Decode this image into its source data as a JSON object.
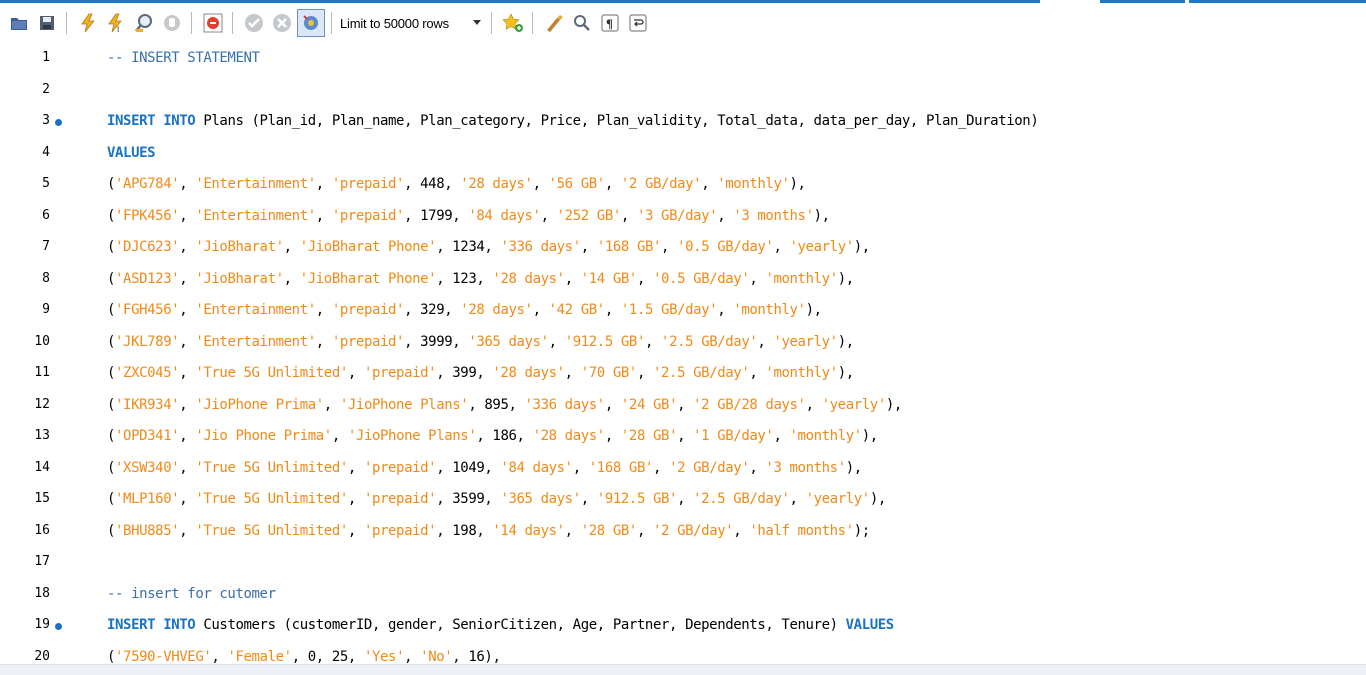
{
  "toolbar": {
    "buttons_left": [
      {
        "name": "open-folder-icon",
        "color": "#4a6a9a"
      },
      {
        "name": "save-icon",
        "color": "#5a6a7a"
      },
      {
        "name": "execute-icon",
        "color": "#e0a020"
      },
      {
        "name": "execute-current-icon",
        "color": "#e0a020"
      },
      {
        "name": "explain-icon",
        "color": "#5a6a7a"
      },
      {
        "name": "stop-icon",
        "color": "#b0b0b0"
      }
    ],
    "limit_label": "Limit to 50000 rows",
    "accent": "#1e78c8"
  },
  "editor": {
    "colors": {
      "keyword": "#1a73c0",
      "string": "#f08a17",
      "comment": "#3a6fa8",
      "statement_dot": "#1e6fc8"
    },
    "lines": [
      {
        "n": "1",
        "dot": false,
        "tokens": [
          {
            "t": "-- INSERT STATEMENT",
            "c": "cmt"
          }
        ]
      },
      {
        "n": "2",
        "dot": false,
        "tokens": []
      },
      {
        "n": "3",
        "dot": true,
        "tokens": [
          {
            "t": "INSERT INTO",
            "c": "kw"
          },
          {
            "t": " Plans (Plan_id, Plan_name, Plan_category, Price, Plan_validity, Total_data, data_per_day, Plan_Duration)",
            "c": "txt"
          }
        ]
      },
      {
        "n": "4",
        "dot": false,
        "tokens": [
          {
            "t": "VALUES",
            "c": "kw"
          }
        ]
      },
      {
        "n": "5",
        "dot": false,
        "tokens": [
          {
            "t": "(",
            "c": "txt"
          },
          {
            "t": "'APG784'",
            "c": "str"
          },
          {
            "t": ", ",
            "c": "txt"
          },
          {
            "t": "'Entertainment'",
            "c": "str"
          },
          {
            "t": ", ",
            "c": "txt"
          },
          {
            "t": "'prepaid'",
            "c": "str"
          },
          {
            "t": ", 448, ",
            "c": "txt"
          },
          {
            "t": "'28 days'",
            "c": "str"
          },
          {
            "t": ", ",
            "c": "txt"
          },
          {
            "t": "'56 GB'",
            "c": "str"
          },
          {
            "t": ", ",
            "c": "txt"
          },
          {
            "t": "'2 GB/day'",
            "c": "str"
          },
          {
            "t": ", ",
            "c": "txt"
          },
          {
            "t": "'monthly'",
            "c": "str"
          },
          {
            "t": "),",
            "c": "txt"
          }
        ]
      },
      {
        "n": "6",
        "dot": false,
        "tokens": [
          {
            "t": "(",
            "c": "txt"
          },
          {
            "t": "'FPK456'",
            "c": "str"
          },
          {
            "t": ", ",
            "c": "txt"
          },
          {
            "t": "'Entertainment'",
            "c": "str"
          },
          {
            "t": ", ",
            "c": "txt"
          },
          {
            "t": "'prepaid'",
            "c": "str"
          },
          {
            "t": ", 1799, ",
            "c": "txt"
          },
          {
            "t": "'84 days'",
            "c": "str"
          },
          {
            "t": ", ",
            "c": "txt"
          },
          {
            "t": "'252 GB'",
            "c": "str"
          },
          {
            "t": ", ",
            "c": "txt"
          },
          {
            "t": "'3 GB/day'",
            "c": "str"
          },
          {
            "t": ", ",
            "c": "txt"
          },
          {
            "t": "'3 months'",
            "c": "str"
          },
          {
            "t": "),",
            "c": "txt"
          }
        ]
      },
      {
        "n": "7",
        "dot": false,
        "tokens": [
          {
            "t": "(",
            "c": "txt"
          },
          {
            "t": "'DJC623'",
            "c": "str"
          },
          {
            "t": ", ",
            "c": "txt"
          },
          {
            "t": "'JioBharat'",
            "c": "str"
          },
          {
            "t": ", ",
            "c": "txt"
          },
          {
            "t": "'JioBharat Phone'",
            "c": "str"
          },
          {
            "t": ", 1234, ",
            "c": "txt"
          },
          {
            "t": "'336 days'",
            "c": "str"
          },
          {
            "t": ", ",
            "c": "txt"
          },
          {
            "t": "'168 GB'",
            "c": "str"
          },
          {
            "t": ", ",
            "c": "txt"
          },
          {
            "t": "'0.5 GB/day'",
            "c": "str"
          },
          {
            "t": ", ",
            "c": "txt"
          },
          {
            "t": "'yearly'",
            "c": "str"
          },
          {
            "t": "),",
            "c": "txt"
          }
        ]
      },
      {
        "n": "8",
        "dot": false,
        "tokens": [
          {
            "t": "(",
            "c": "txt"
          },
          {
            "t": "'ASD123'",
            "c": "str"
          },
          {
            "t": ", ",
            "c": "txt"
          },
          {
            "t": "'JioBharat'",
            "c": "str"
          },
          {
            "t": ", ",
            "c": "txt"
          },
          {
            "t": "'JioBharat Phone'",
            "c": "str"
          },
          {
            "t": ", 123, ",
            "c": "txt"
          },
          {
            "t": "'28 days'",
            "c": "str"
          },
          {
            "t": ", ",
            "c": "txt"
          },
          {
            "t": "'14 GB'",
            "c": "str"
          },
          {
            "t": ", ",
            "c": "txt"
          },
          {
            "t": "'0.5 GB/day'",
            "c": "str"
          },
          {
            "t": ", ",
            "c": "txt"
          },
          {
            "t": "'monthly'",
            "c": "str"
          },
          {
            "t": "),",
            "c": "txt"
          }
        ]
      },
      {
        "n": "9",
        "dot": false,
        "tokens": [
          {
            "t": "(",
            "c": "txt"
          },
          {
            "t": "'FGH456'",
            "c": "str"
          },
          {
            "t": ", ",
            "c": "txt"
          },
          {
            "t": "'Entertainment'",
            "c": "str"
          },
          {
            "t": ", ",
            "c": "txt"
          },
          {
            "t": "'prepaid'",
            "c": "str"
          },
          {
            "t": ", 329, ",
            "c": "txt"
          },
          {
            "t": "'28 days'",
            "c": "str"
          },
          {
            "t": ", ",
            "c": "txt"
          },
          {
            "t": "'42 GB'",
            "c": "str"
          },
          {
            "t": ", ",
            "c": "txt"
          },
          {
            "t": "'1.5 GB/day'",
            "c": "str"
          },
          {
            "t": ", ",
            "c": "txt"
          },
          {
            "t": "'monthly'",
            "c": "str"
          },
          {
            "t": "),",
            "c": "txt"
          }
        ]
      },
      {
        "n": "10",
        "dot": false,
        "tokens": [
          {
            "t": "(",
            "c": "txt"
          },
          {
            "t": "'JKL789'",
            "c": "str"
          },
          {
            "t": ", ",
            "c": "txt"
          },
          {
            "t": "'Entertainment'",
            "c": "str"
          },
          {
            "t": ", ",
            "c": "txt"
          },
          {
            "t": "'prepaid'",
            "c": "str"
          },
          {
            "t": ", 3999, ",
            "c": "txt"
          },
          {
            "t": "'365 days'",
            "c": "str"
          },
          {
            "t": ", ",
            "c": "txt"
          },
          {
            "t": "'912.5 GB'",
            "c": "str"
          },
          {
            "t": ", ",
            "c": "txt"
          },
          {
            "t": "'2.5 GB/day'",
            "c": "str"
          },
          {
            "t": ", ",
            "c": "txt"
          },
          {
            "t": "'yearly'",
            "c": "str"
          },
          {
            "t": "),",
            "c": "txt"
          }
        ]
      },
      {
        "n": "11",
        "dot": false,
        "tokens": [
          {
            "t": "(",
            "c": "txt"
          },
          {
            "t": "'ZXC045'",
            "c": "str"
          },
          {
            "t": ", ",
            "c": "txt"
          },
          {
            "t": "'True 5G Unlimited'",
            "c": "str"
          },
          {
            "t": ", ",
            "c": "txt"
          },
          {
            "t": "'prepaid'",
            "c": "str"
          },
          {
            "t": ", 399, ",
            "c": "txt"
          },
          {
            "t": "'28 days'",
            "c": "str"
          },
          {
            "t": ", ",
            "c": "txt"
          },
          {
            "t": "'70 GB'",
            "c": "str"
          },
          {
            "t": ", ",
            "c": "txt"
          },
          {
            "t": "'2.5 GB/day'",
            "c": "str"
          },
          {
            "t": ", ",
            "c": "txt"
          },
          {
            "t": "'monthly'",
            "c": "str"
          },
          {
            "t": "),",
            "c": "txt"
          }
        ]
      },
      {
        "n": "12",
        "dot": false,
        "tokens": [
          {
            "t": "(",
            "c": "txt"
          },
          {
            "t": "'IKR934'",
            "c": "str"
          },
          {
            "t": ", ",
            "c": "txt"
          },
          {
            "t": "'JioPhone Prima'",
            "c": "str"
          },
          {
            "t": ", ",
            "c": "txt"
          },
          {
            "t": "'JioPhone Plans'",
            "c": "str"
          },
          {
            "t": ", 895, ",
            "c": "txt"
          },
          {
            "t": "'336 days'",
            "c": "str"
          },
          {
            "t": ", ",
            "c": "txt"
          },
          {
            "t": "'24 GB'",
            "c": "str"
          },
          {
            "t": ", ",
            "c": "txt"
          },
          {
            "t": "'2 GB/28 days'",
            "c": "str"
          },
          {
            "t": ", ",
            "c": "txt"
          },
          {
            "t": "'yearly'",
            "c": "str"
          },
          {
            "t": "),",
            "c": "txt"
          }
        ]
      },
      {
        "n": "13",
        "dot": false,
        "tokens": [
          {
            "t": "(",
            "c": "txt"
          },
          {
            "t": "'OPD341'",
            "c": "str"
          },
          {
            "t": ", ",
            "c": "txt"
          },
          {
            "t": "'Jio Phone Prima'",
            "c": "str"
          },
          {
            "t": ", ",
            "c": "txt"
          },
          {
            "t": "'JioPhone Plans'",
            "c": "str"
          },
          {
            "t": ", 186, ",
            "c": "txt"
          },
          {
            "t": "'28 days'",
            "c": "str"
          },
          {
            "t": ", ",
            "c": "txt"
          },
          {
            "t": "'28 GB'",
            "c": "str"
          },
          {
            "t": ", ",
            "c": "txt"
          },
          {
            "t": "'1 GB/day'",
            "c": "str"
          },
          {
            "t": ", ",
            "c": "txt"
          },
          {
            "t": "'monthly'",
            "c": "str"
          },
          {
            "t": "),",
            "c": "txt"
          }
        ]
      },
      {
        "n": "14",
        "dot": false,
        "tokens": [
          {
            "t": "(",
            "c": "txt"
          },
          {
            "t": "'XSW340'",
            "c": "str"
          },
          {
            "t": ", ",
            "c": "txt"
          },
          {
            "t": "'True 5G Unlimited'",
            "c": "str"
          },
          {
            "t": ", ",
            "c": "txt"
          },
          {
            "t": "'prepaid'",
            "c": "str"
          },
          {
            "t": ", 1049, ",
            "c": "txt"
          },
          {
            "t": "'84 days'",
            "c": "str"
          },
          {
            "t": ", ",
            "c": "txt"
          },
          {
            "t": "'168 GB'",
            "c": "str"
          },
          {
            "t": ", ",
            "c": "txt"
          },
          {
            "t": "'2 GB/day'",
            "c": "str"
          },
          {
            "t": ", ",
            "c": "txt"
          },
          {
            "t": "'3 months'",
            "c": "str"
          },
          {
            "t": "),",
            "c": "txt"
          }
        ]
      },
      {
        "n": "15",
        "dot": false,
        "tokens": [
          {
            "t": "(",
            "c": "txt"
          },
          {
            "t": "'MLP160'",
            "c": "str"
          },
          {
            "t": ", ",
            "c": "txt"
          },
          {
            "t": "'True 5G Unlimited'",
            "c": "str"
          },
          {
            "t": ", ",
            "c": "txt"
          },
          {
            "t": "'prepaid'",
            "c": "str"
          },
          {
            "t": ", 3599, ",
            "c": "txt"
          },
          {
            "t": "'365 days'",
            "c": "str"
          },
          {
            "t": ", ",
            "c": "txt"
          },
          {
            "t": "'912.5 GB'",
            "c": "str"
          },
          {
            "t": ", ",
            "c": "txt"
          },
          {
            "t": "'2.5 GB/day'",
            "c": "str"
          },
          {
            "t": ", ",
            "c": "txt"
          },
          {
            "t": "'yearly'",
            "c": "str"
          },
          {
            "t": "),",
            "c": "txt"
          }
        ]
      },
      {
        "n": "16",
        "dot": false,
        "tokens": [
          {
            "t": "(",
            "c": "txt"
          },
          {
            "t": "'BHU885'",
            "c": "str"
          },
          {
            "t": ", ",
            "c": "txt"
          },
          {
            "t": "'True 5G Unlimited'",
            "c": "str"
          },
          {
            "t": ", ",
            "c": "txt"
          },
          {
            "t": "'prepaid'",
            "c": "str"
          },
          {
            "t": ", 198, ",
            "c": "txt"
          },
          {
            "t": "'14 days'",
            "c": "str"
          },
          {
            "t": ", ",
            "c": "txt"
          },
          {
            "t": "'28 GB'",
            "c": "str"
          },
          {
            "t": ", ",
            "c": "txt"
          },
          {
            "t": "'2 GB/day'",
            "c": "str"
          },
          {
            "t": ", ",
            "c": "txt"
          },
          {
            "t": "'half months'",
            "c": "str"
          },
          {
            "t": ");",
            "c": "txt"
          }
        ]
      },
      {
        "n": "17",
        "dot": false,
        "tokens": []
      },
      {
        "n": "18",
        "dot": false,
        "tokens": [
          {
            "t": "-- insert for cutomer",
            "c": "cmt"
          }
        ]
      },
      {
        "n": "19",
        "dot": true,
        "tokens": [
          {
            "t": "INSERT INTO",
            "c": "kw"
          },
          {
            "t": " Customers (customerID, gender, SeniorCitizen, Age, Partner, Dependents, Tenure) ",
            "c": "txt"
          },
          {
            "t": "VALUES",
            "c": "kw"
          }
        ]
      },
      {
        "n": "20",
        "dot": false,
        "tokens": [
          {
            "t": "(",
            "c": "txt"
          },
          {
            "t": "'7590-VHVEG'",
            "c": "str"
          },
          {
            "t": ", ",
            "c": "txt"
          },
          {
            "t": "'Female'",
            "c": "str"
          },
          {
            "t": ", 0, 25, ",
            "c": "txt"
          },
          {
            "t": "'Yes'",
            "c": "str"
          },
          {
            "t": ", ",
            "c": "txt"
          },
          {
            "t": "'No'",
            "c": "str"
          },
          {
            "t": ", 16),",
            "c": "txt"
          }
        ]
      }
    ]
  }
}
